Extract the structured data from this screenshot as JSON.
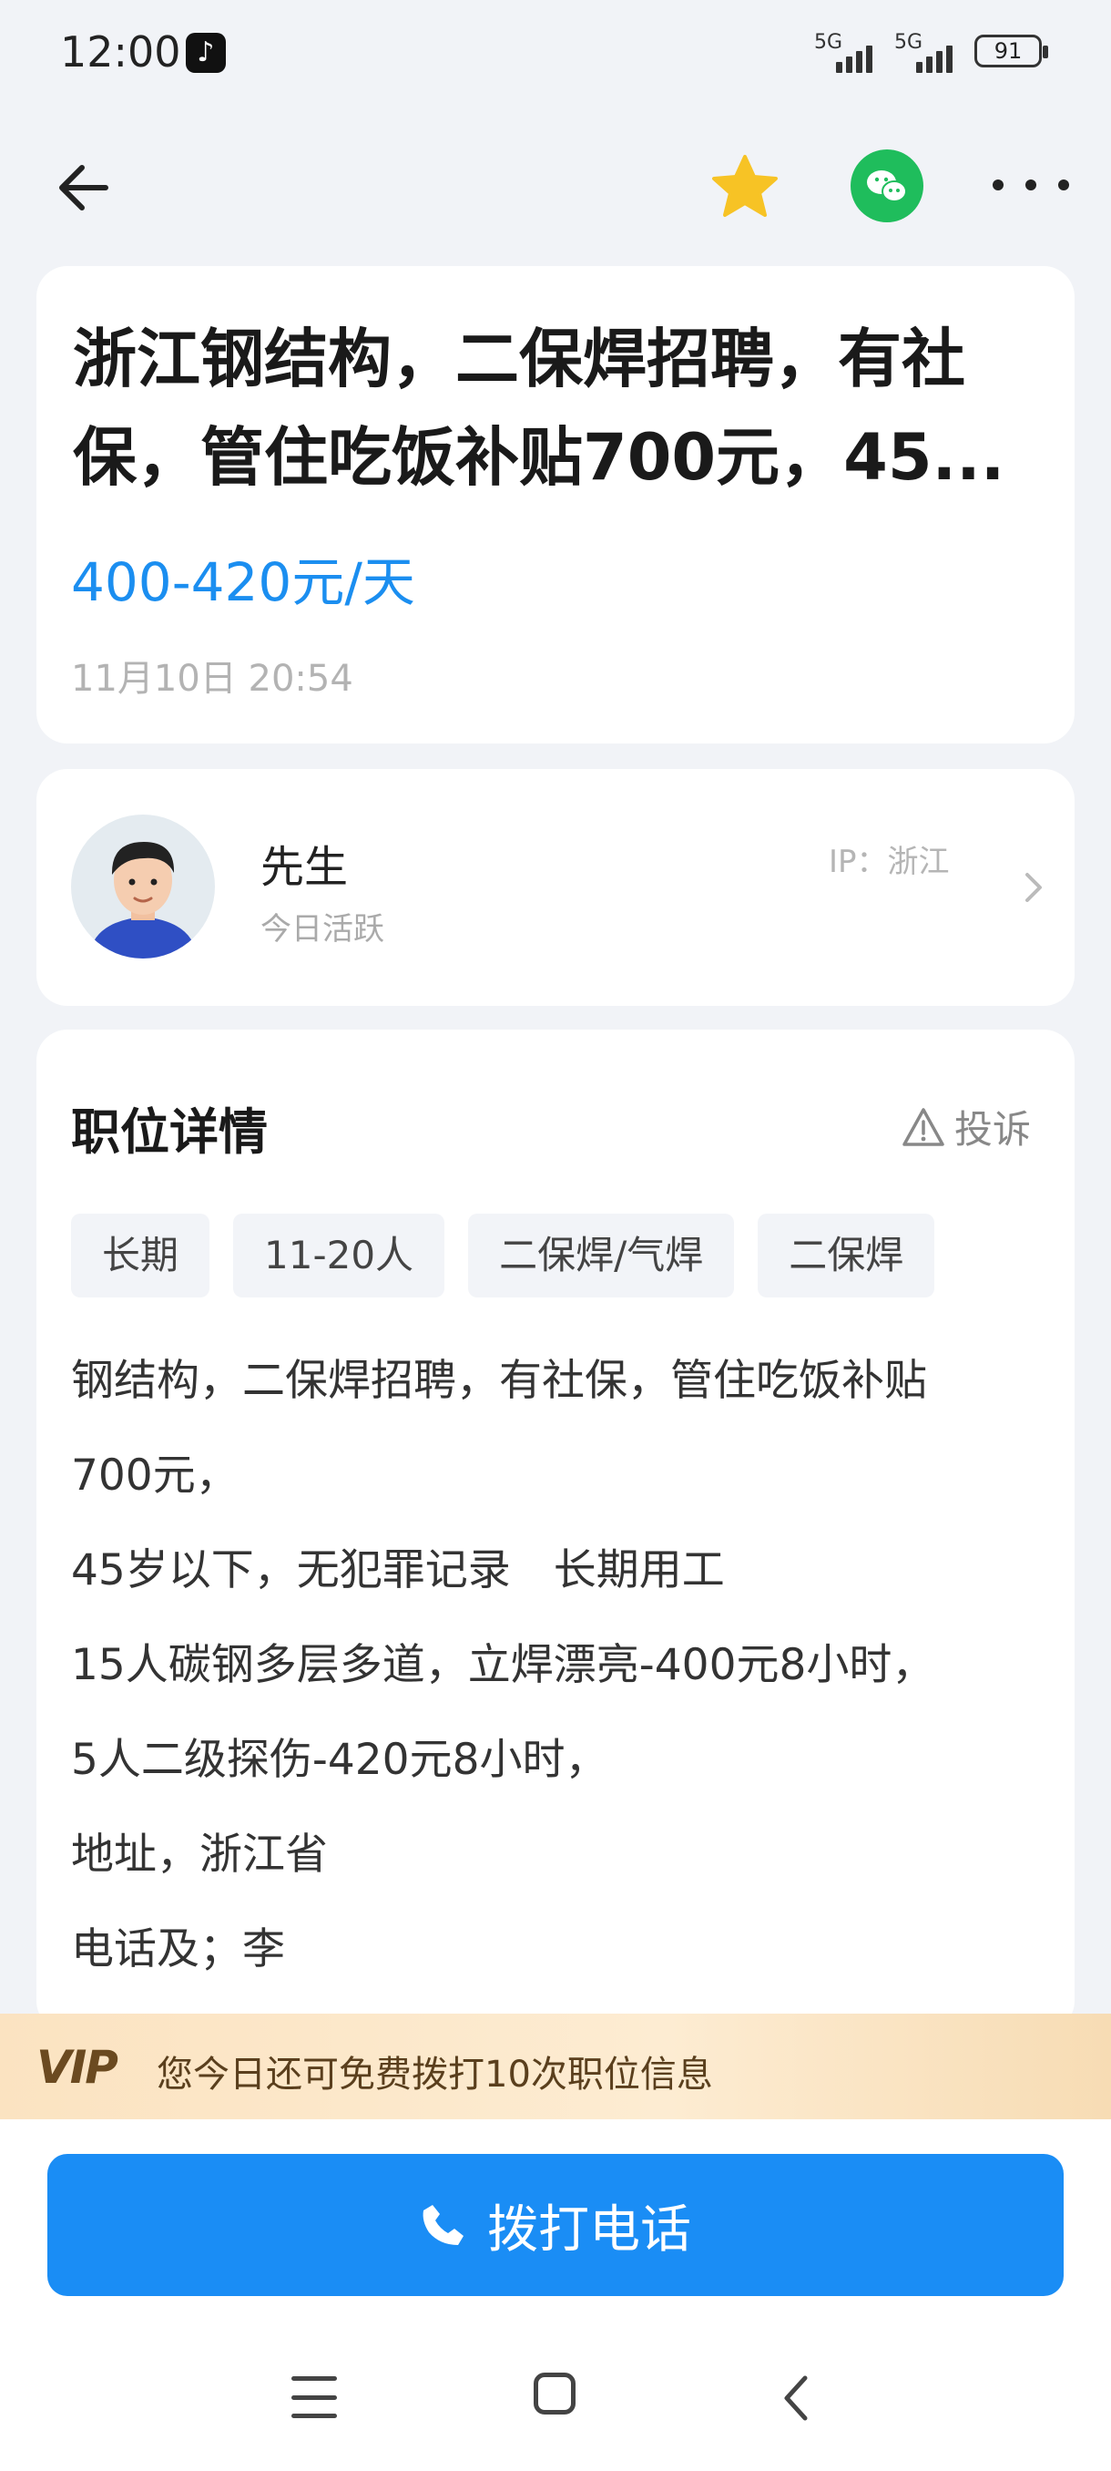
{
  "status_bar": {
    "time": "12:00",
    "net1": "5G",
    "net2": "5G",
    "battery": "91"
  },
  "job": {
    "title": "浙江钢结构，二保焊招聘，有社保，管住吃饭补贴700元，45...",
    "salary": "400-420元/天",
    "date": "11月10日 20:54"
  },
  "poster": {
    "name": "先生",
    "status": "今日活跃",
    "ip": "IP：浙江"
  },
  "details": {
    "section_title": "职位详情",
    "complain_label": "投诉",
    "tags": [
      "长期",
      "11-20人",
      "二保焊/气焊",
      "二保焊"
    ],
    "lines": [
      "钢结构，二保焊招聘，有社保，管住吃饭补贴",
      "700元，",
      "45岁以下，无犯罪记录　长期用工",
      "15人碳钢多层多道，立焊漂亮-400元8小时，",
      "5人二级探伤-420元8小时，",
      "地址，浙江省",
      "电话及；李"
    ]
  },
  "vip": {
    "logo": "VIP",
    "text": "您今日还可免费拨打10次职位信息"
  },
  "call_button": {
    "label": "拨打电话"
  },
  "colors": {
    "accent": "#1a8df5",
    "salary": "#1b8ef0",
    "wechat": "#1fbd5c",
    "star": "#f7c325"
  }
}
